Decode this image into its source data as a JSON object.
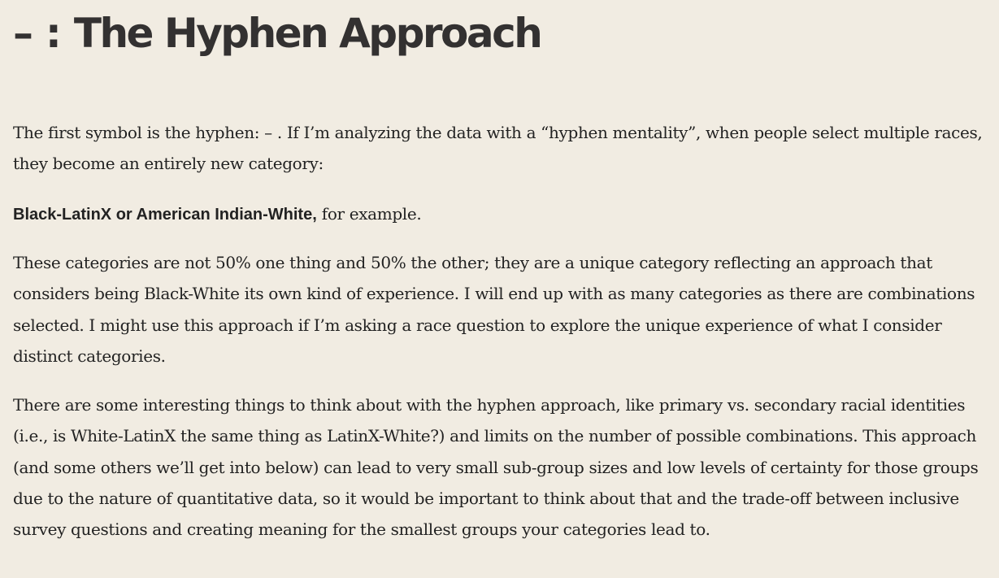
{
  "section": {
    "heading_symbol": "–",
    "heading_separator": ":",
    "heading_title": "The Hyphen Approach"
  },
  "paragraphs": {
    "intro": "The first symbol is the hyphen: – . If I’m analyzing the data with a “hyphen mentality”, when people select multiple races, they become an entirely new category:",
    "example_bold": "Black-LatinX or American Indian-White,",
    "example_rest": " for example.",
    "explanation": "These categories are not 50% one thing and 50% the other; they are a unique category reflecting an approach that considers being Black-White its own kind of experience. I will end up with as many categories as there are combinations selected. I might use this approach if I’m asking a race question to explore the unique experience of what I consider distinct categories.",
    "considerations": "There are some interesting things to think about with the hyphen approach, like primary vs. secondary racial identities (i.e., is White-LatinX the same thing as LatinX-White?) and limits on the number of possible combinations. This approach (and some others we’ll get into below) can lead to very small sub-group sizes and low levels of certainty for those groups due to the nature of quantitative data, so it would be important to think about that and the trade-off between inclusive survey questions and creating meaning for the smallest groups your categories lead to."
  }
}
